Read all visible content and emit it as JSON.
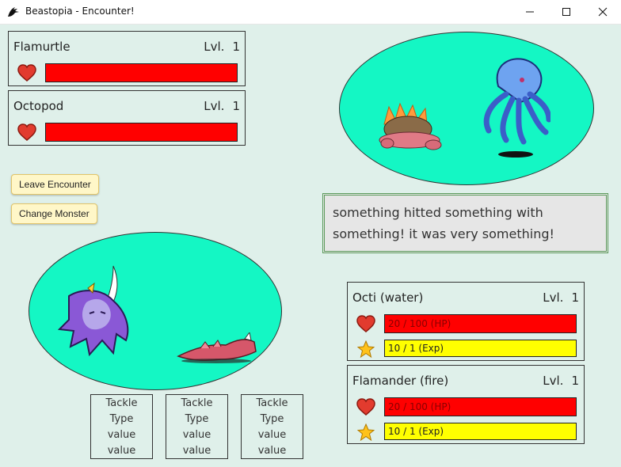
{
  "window": {
    "title": "Beastopia - Encounter!",
    "icon": "dragon-logo-icon"
  },
  "enemies": [
    {
      "name": "Flamurtle",
      "lvl_label": "Lvl.",
      "lvl": "1",
      "hp_fraction": 1.0
    },
    {
      "name": "Octopod",
      "lvl_label": "Lvl.",
      "lvl": "1",
      "hp_fraction": 1.0
    }
  ],
  "buttons": {
    "leave": "Leave Encounter",
    "change": "Change Monster"
  },
  "message": "something hitted something with something! it was very something!",
  "team": [
    {
      "name": "Octi (water)",
      "lvl_label": "Lvl.",
      "lvl": "1",
      "hp_text": "20 / 100 (HP)",
      "exp_text": "10 / 1 (Exp)"
    },
    {
      "name": "Flamander (fire)",
      "lvl_label": "Lvl.",
      "lvl": "1",
      "hp_text": "20 / 100 (HP)",
      "exp_text": "10 / 1 (Exp)"
    }
  ],
  "moves": [
    {
      "name": "Tackle",
      "type": "Type",
      "value1": "value",
      "value2": "value"
    },
    {
      "name": "Tackle",
      "type": "Type",
      "value1": "value",
      "value2": "value"
    },
    {
      "name": "Tackle",
      "type": "Type",
      "value1": "value",
      "value2": "value"
    }
  ],
  "colors": {
    "background": "#dff0ea",
    "arena": "#14f7c4",
    "hp_bar": "#ff0000",
    "exp_bar": "#ffff00",
    "button": "#fff7c8"
  }
}
